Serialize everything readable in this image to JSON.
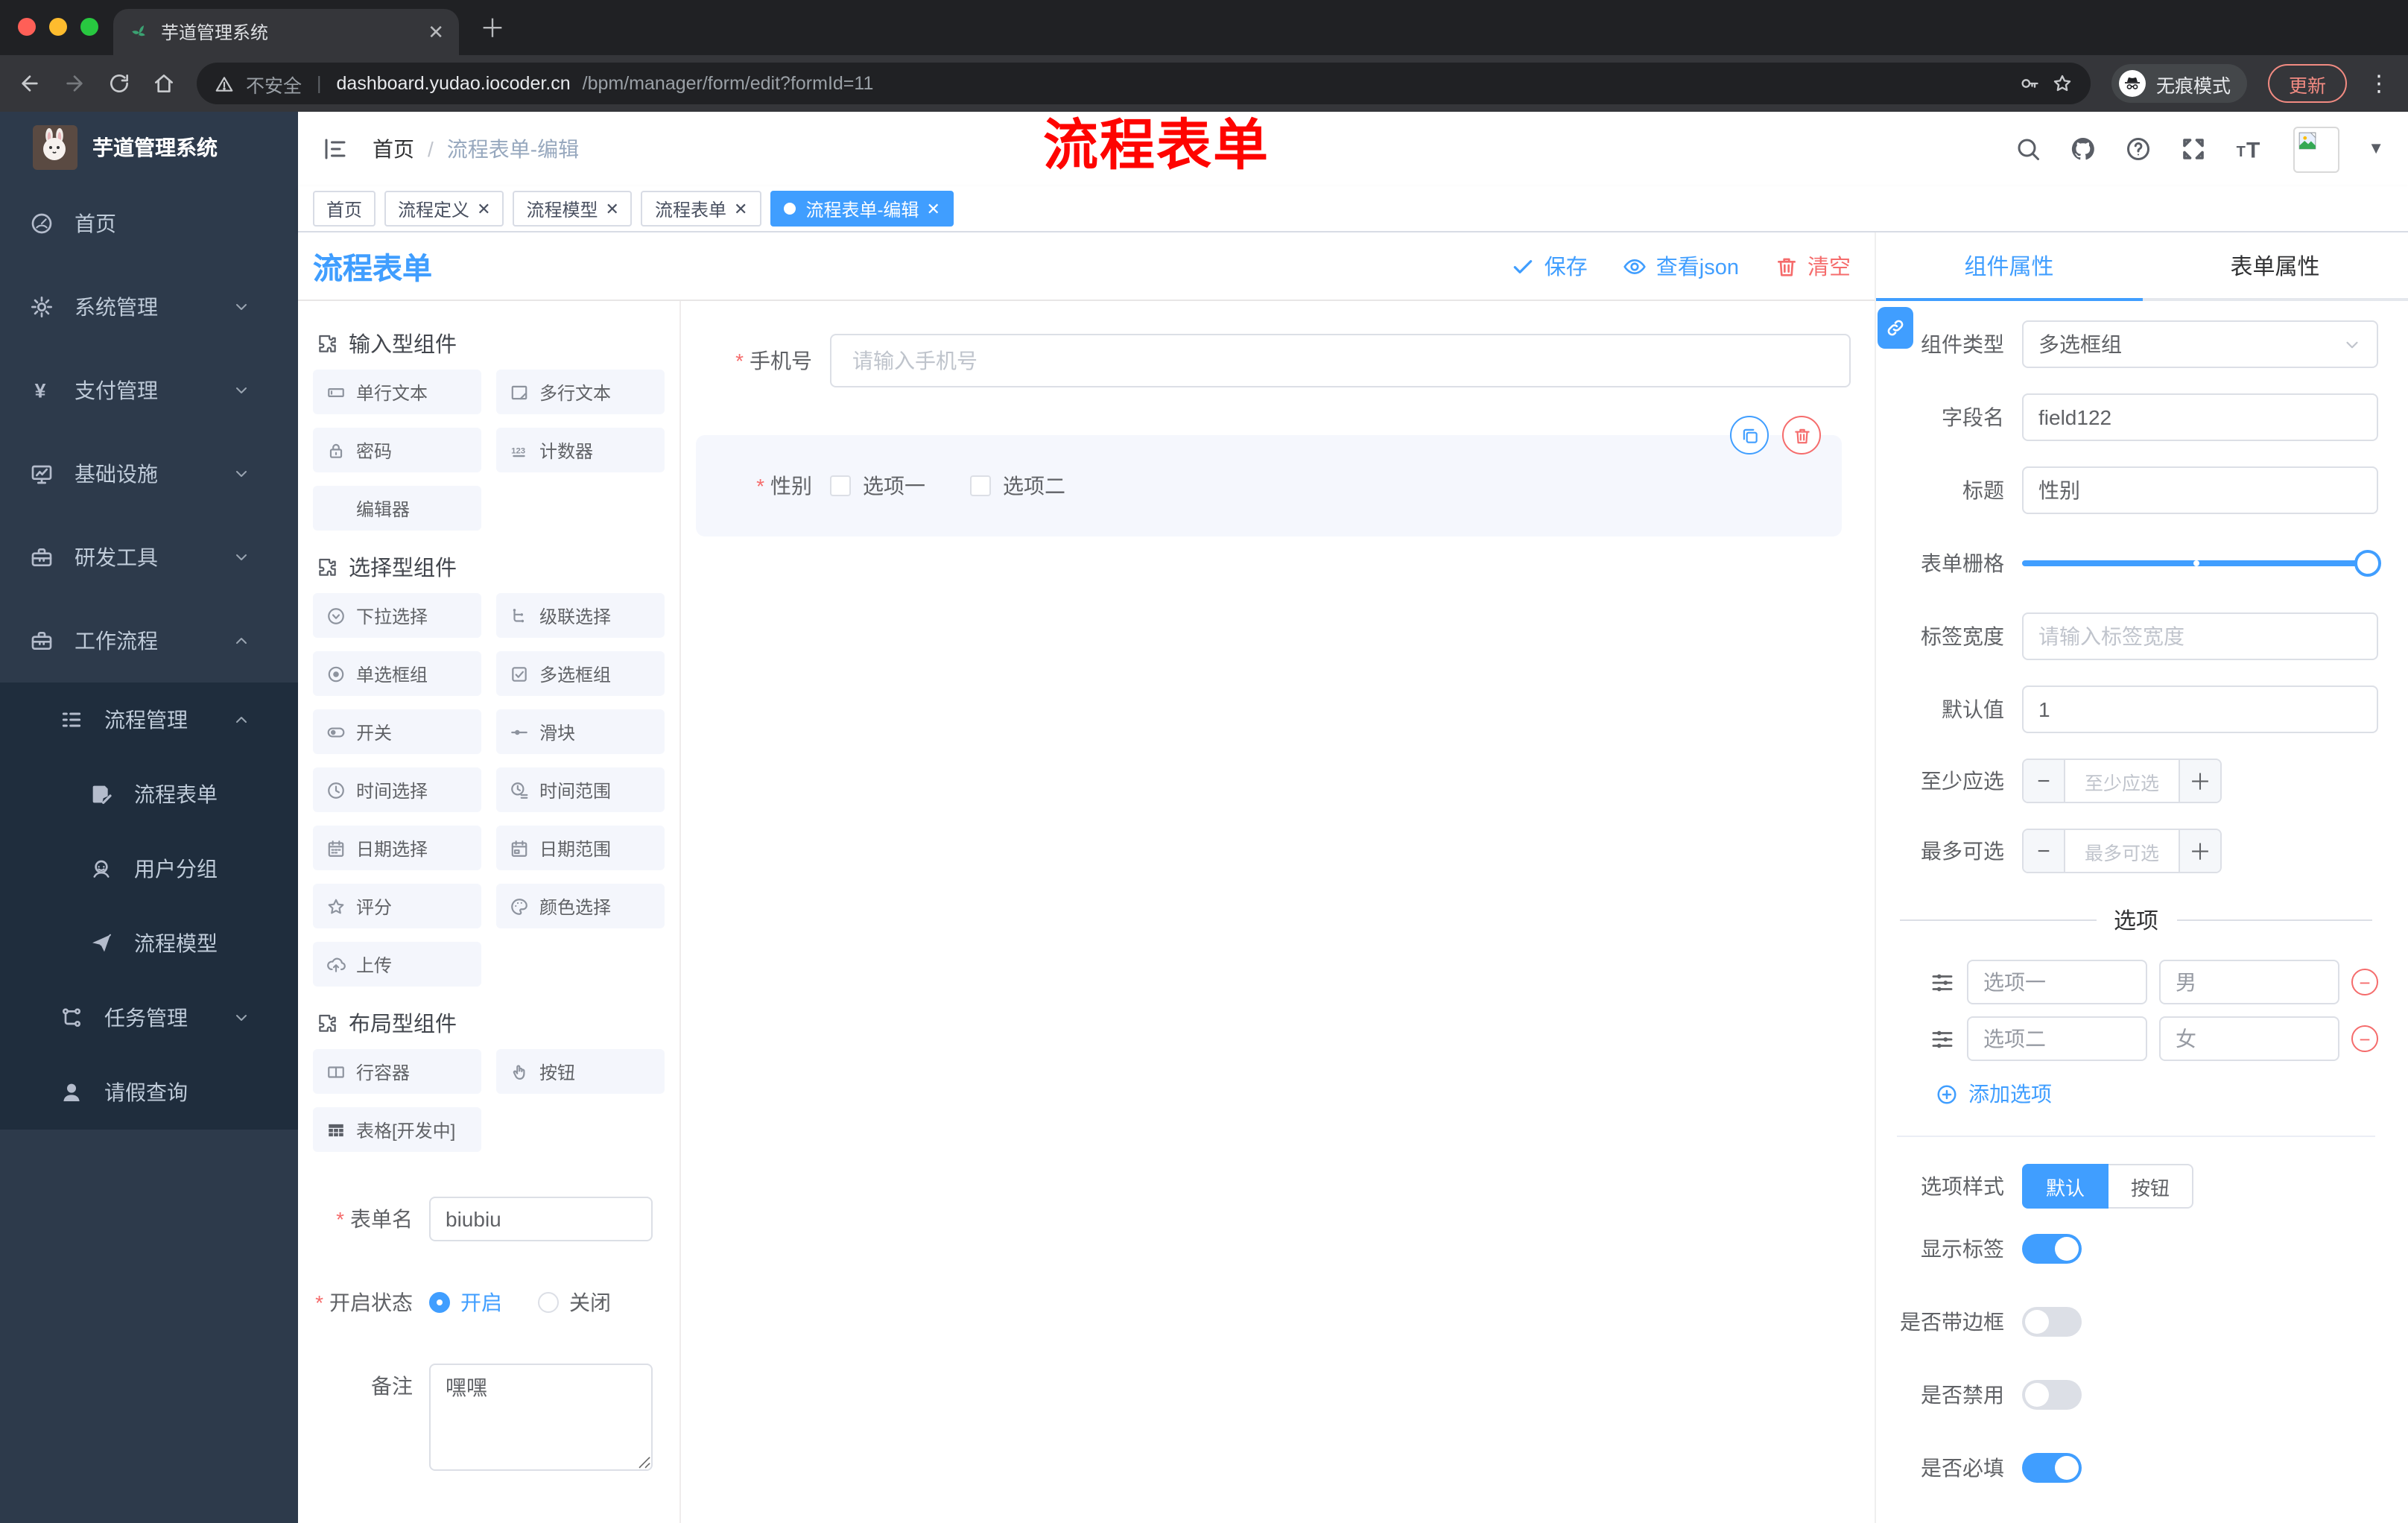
{
  "browser": {
    "tab_title": "芋道管理系统",
    "security_label": "不安全",
    "url_host": "dashboard.yudao.iocoder.cn",
    "url_path": "/bpm/manager/form/edit?formId=11",
    "incognito_label": "无痕模式",
    "update_label": "更新"
  },
  "sidebar": {
    "app_title": "芋道管理系统",
    "menu": [
      {
        "label": "首页",
        "icon": "gauge",
        "level": 1
      },
      {
        "label": "系统管理",
        "icon": "gear",
        "level": 1,
        "chevron": "down"
      },
      {
        "label": "支付管理",
        "icon": "yen",
        "level": 1,
        "chevron": "down"
      },
      {
        "label": "基础设施",
        "icon": "monitor",
        "level": 1,
        "chevron": "down"
      },
      {
        "label": "研发工具",
        "icon": "toolbox",
        "level": 1,
        "chevron": "down"
      },
      {
        "label": "工作流程",
        "icon": "toolbox",
        "level": 1,
        "chevron": "up"
      },
      {
        "label": "流程管理",
        "icon": "list-tree",
        "level": 2,
        "chevron": "up",
        "sub": true
      },
      {
        "label": "流程表单",
        "icon": "doc-edit",
        "level": 3,
        "sub": true
      },
      {
        "label": "用户分组",
        "icon": "users",
        "level": 3,
        "sub": true
      },
      {
        "label": "流程模型",
        "icon": "send",
        "level": 3,
        "sub": true
      },
      {
        "label": "任务管理",
        "icon": "tree",
        "level": 2,
        "chevron": "down",
        "sub": true
      },
      {
        "label": "请假查询",
        "icon": "user",
        "level": 2,
        "sub": true
      }
    ]
  },
  "header": {
    "breadcrumb": {
      "home": "首页",
      "current": "流程表单-编辑"
    },
    "annotation": "流程表单"
  },
  "tags": [
    {
      "label": "首页",
      "closable": false,
      "active": false
    },
    {
      "label": "流程定义",
      "closable": true,
      "active": false
    },
    {
      "label": "流程模型",
      "closable": true,
      "active": false
    },
    {
      "label": "流程表单",
      "closable": true,
      "active": false
    },
    {
      "label": "流程表单-编辑",
      "closable": true,
      "active": true
    }
  ],
  "builder": {
    "title": "流程表单",
    "toolbar": {
      "save": "保存",
      "view_json": "查看json",
      "clear": "清空"
    }
  },
  "palette": {
    "sections": [
      {
        "title": "输入型组件",
        "items": [
          {
            "label": "单行文本",
            "icon": "input"
          },
          {
            "label": "多行文本",
            "icon": "textarea"
          },
          {
            "label": "密码",
            "icon": "lock"
          },
          {
            "label": "计数器",
            "icon": "counter"
          },
          {
            "label": "编辑器",
            "icon": "none"
          }
        ]
      },
      {
        "title": "选择型组件",
        "items": [
          {
            "label": "下拉选择",
            "icon": "select"
          },
          {
            "label": "级联选择",
            "icon": "cascader"
          },
          {
            "label": "单选框组",
            "icon": "radio"
          },
          {
            "label": "多选框组",
            "icon": "checkbox"
          },
          {
            "label": "开关",
            "icon": "switch"
          },
          {
            "label": "滑块",
            "icon": "slider"
          },
          {
            "label": "时间选择",
            "icon": "time"
          },
          {
            "label": "时间范围",
            "icon": "time-range"
          },
          {
            "label": "日期选择",
            "icon": "date"
          },
          {
            "label": "日期范围",
            "icon": "date-range"
          },
          {
            "label": "评分",
            "icon": "star"
          },
          {
            "label": "颜色选择",
            "icon": "palette"
          },
          {
            "label": "上传",
            "icon": "upload"
          }
        ]
      },
      {
        "title": "布局型组件",
        "items": [
          {
            "label": "行容器",
            "icon": "row"
          },
          {
            "label": "按钮",
            "icon": "button"
          },
          {
            "label": "表格[开发中]",
            "icon": "table"
          }
        ]
      }
    ]
  },
  "meta_form": {
    "form_name": {
      "label": "表单名",
      "value": "biubiu",
      "required": true
    },
    "status": {
      "label": "开启状态",
      "required": true,
      "options": [
        {
          "label": "开启",
          "selected": true
        },
        {
          "label": "关闭",
          "selected": false
        }
      ]
    },
    "remark": {
      "label": "备注",
      "value": "嘿嘿"
    }
  },
  "canvas": {
    "phone": {
      "label": "手机号",
      "placeholder": "请输入手机号",
      "required": true
    },
    "gender": {
      "label": "性别",
      "required": true,
      "options": [
        "选项一",
        "选项二"
      ]
    }
  },
  "props": {
    "tabs": [
      {
        "label": "组件属性",
        "active": true
      },
      {
        "label": "表单属性",
        "active": false
      }
    ],
    "comp_type": {
      "label": "组件类型",
      "value": "多选框组"
    },
    "field_name": {
      "label": "字段名",
      "value": "field122"
    },
    "title": {
      "label": "标题",
      "value": "性别"
    },
    "grid": {
      "label": "表单栅格"
    },
    "label_width": {
      "label": "标签宽度",
      "placeholder": "请输入标签宽度"
    },
    "default_val": {
      "label": "默认值",
      "value": "1"
    },
    "min_check": {
      "label": "至少应选",
      "placeholder": "至少应选"
    },
    "max_check": {
      "label": "最多可选",
      "placeholder": "最多可选"
    },
    "options_divider": "选项",
    "options": [
      {
        "label": "选项一",
        "value": "男"
      },
      {
        "label": "选项二",
        "value": "女"
      }
    ],
    "add_option": "添加选项",
    "option_style": {
      "label": "选项样式",
      "choices": [
        {
          "label": "默认",
          "active": true
        },
        {
          "label": "按钮",
          "active": false
        }
      ]
    },
    "switches": [
      {
        "label": "显示标签",
        "on": true
      },
      {
        "label": "是否带边框",
        "on": false
      },
      {
        "label": "是否禁用",
        "on": false
      },
      {
        "label": "是否必填",
        "on": true
      }
    ]
  },
  "colors": {
    "accent": "#409eff",
    "danger": "#f56c6c",
    "annotation_red": "#fe0400"
  }
}
